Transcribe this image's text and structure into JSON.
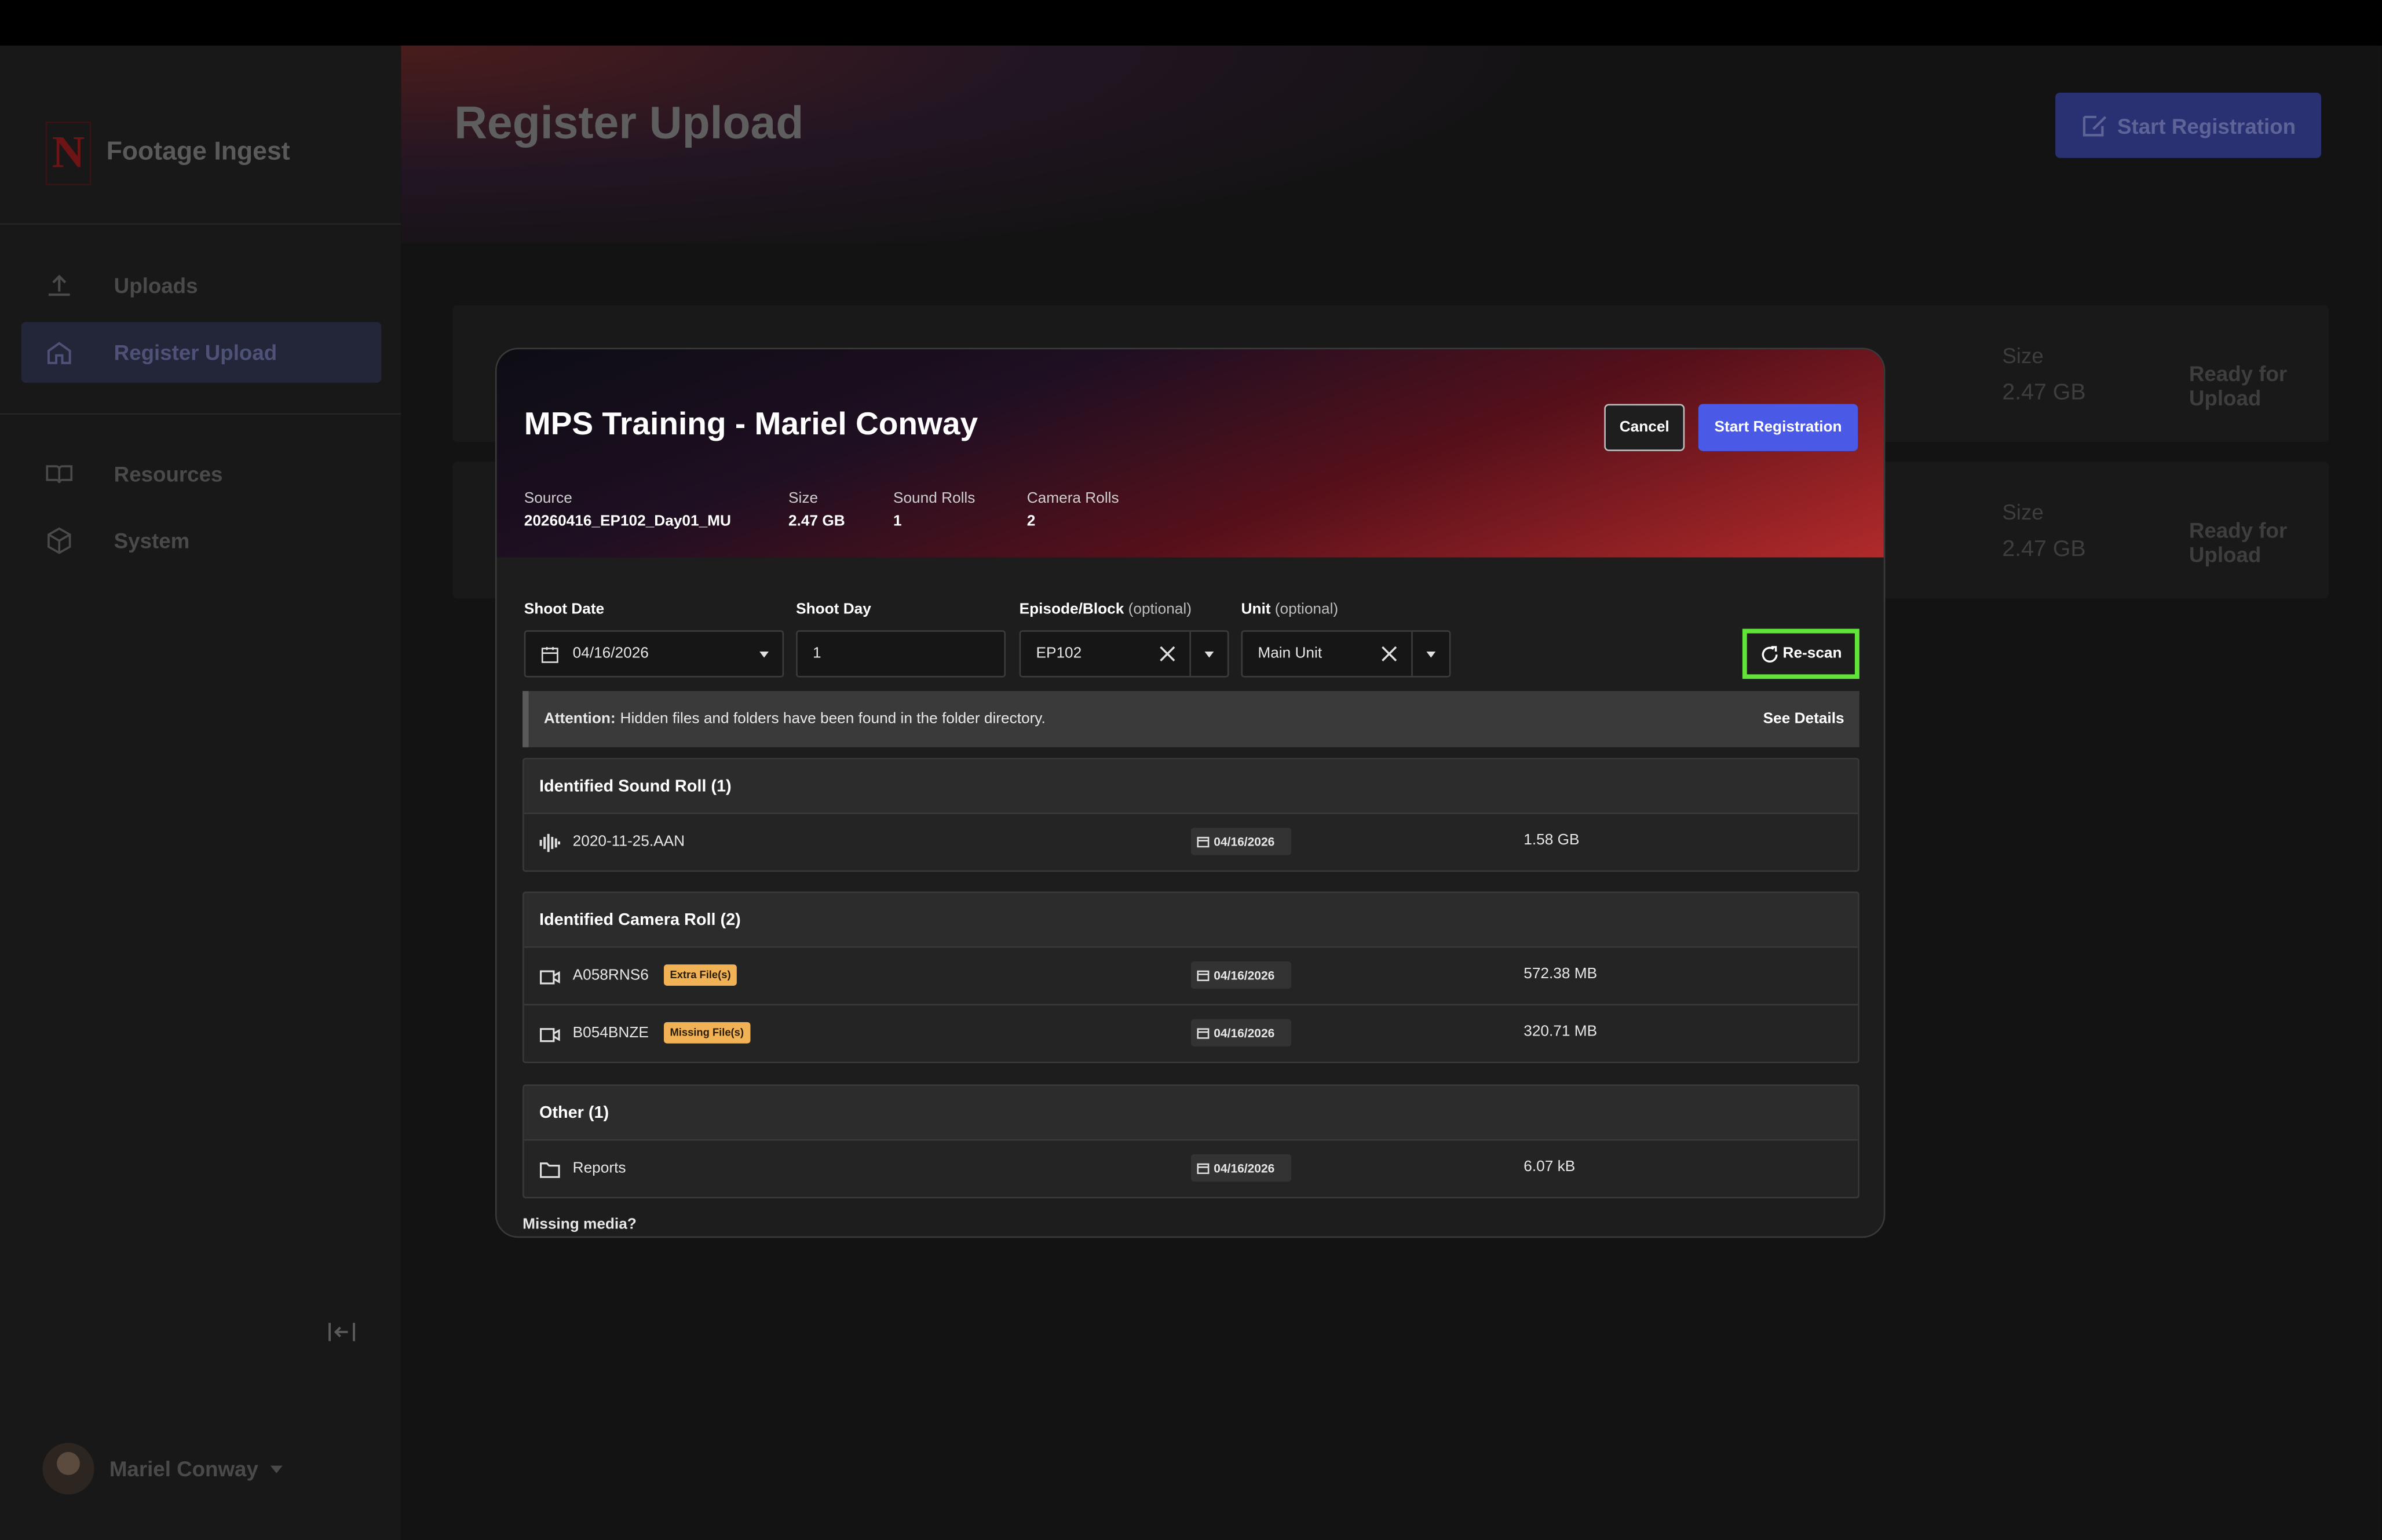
{
  "app": {
    "title": "Footage Ingest",
    "logo_letter": "N"
  },
  "sidebar": {
    "items": [
      {
        "label": "Uploads",
        "icon": "upload-icon"
      },
      {
        "label": "Register Upload",
        "icon": "home-icon",
        "active": true
      },
      {
        "label": "Resources",
        "icon": "book-icon"
      },
      {
        "label": "System",
        "icon": "cube-icon"
      }
    ],
    "user": {
      "name": "Mariel Conway"
    }
  },
  "page": {
    "title": "Register Upload",
    "start_button": "Start Registration",
    "rows": [
      {
        "size_label": "Size",
        "size_value": "2.47 GB",
        "status": "Ready for Upload"
      },
      {
        "size_label": "Size",
        "size_value": "2.47 GB",
        "status": "Ready for Upload"
      }
    ]
  },
  "modal": {
    "title": "MPS Training - Mariel Conway",
    "cancel_label": "Cancel",
    "start_label": "Start Registration",
    "meta": {
      "source_label": "Source",
      "source_value": "20260416_EP102_Day01_MU",
      "size_label": "Size",
      "size_value": "2.47 GB",
      "sound_label": "Sound Rolls",
      "sound_value": "1",
      "camera_label": "Camera Rolls",
      "camera_value": "2"
    },
    "form": {
      "shoot_date_label": "Shoot Date",
      "shoot_date_value": "04/16/2026",
      "shoot_day_label": "Shoot Day",
      "shoot_day_value": "1",
      "episode_label": "Episode/Block",
      "episode_optional": "(optional)",
      "episode_value": "EP102",
      "unit_label": "Unit",
      "unit_optional": "(optional)",
      "unit_value": "Main Unit",
      "rescan_label": "Re-scan"
    },
    "attention": {
      "prefix": "Attention:",
      "message": "Hidden files and folders have been found in the folder directory.",
      "link": "See Details"
    },
    "sections": {
      "sound": {
        "title": "Identified Sound Roll (1)",
        "rows": [
          {
            "name": "2020-11-25.AAN",
            "date": "04/16/2026",
            "size": "1.58 GB"
          }
        ]
      },
      "camera": {
        "title": "Identified Camera Roll (2)",
        "rows": [
          {
            "name": "A058RNS6",
            "badge": "Extra File(s)",
            "date": "04/16/2026",
            "size": "572.38 MB"
          },
          {
            "name": "B054BNZE",
            "badge": "Missing File(s)",
            "date": "04/16/2026",
            "size": "320.71 MB"
          }
        ]
      },
      "other": {
        "title": "Other (1)",
        "rows": [
          {
            "name": "Reports",
            "date": "04/16/2026",
            "size": "6.07 kB"
          }
        ]
      }
    },
    "footer_text": "Missing media?"
  },
  "colors": {
    "accent": "#4a5ae6",
    "highlight": "#62e33a",
    "badge": "#f0b254"
  }
}
